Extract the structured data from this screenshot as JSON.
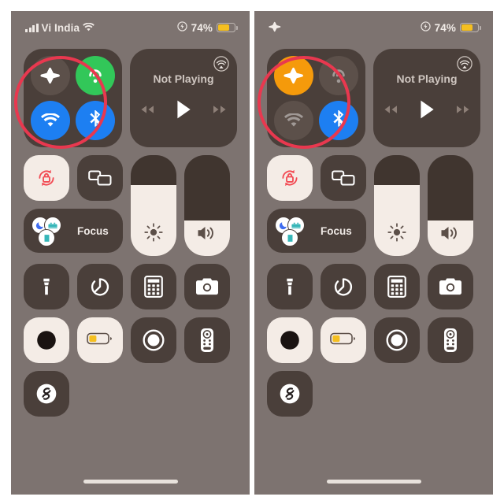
{
  "meta": {
    "screen_bg": "#7d7370",
    "tile_bg": "#4a3f3a",
    "accent_orange": "#f59a0b",
    "accent_blue": "#1d7ff2",
    "accent_green": "#32c759",
    "accent_red": "#e8384f",
    "active_tile_bg": "#f4ece6",
    "battery_yellow": "#f5bf20"
  },
  "panels": [
    {
      "id": "before",
      "status_bar": {
        "carrier": "Vi India",
        "signal_icon": "cellular-signal-icon",
        "wifi_icon": "wifi-icon",
        "airplane_icon": "",
        "lowpower_icon": "low-power-mode-icon",
        "battery_percent": "74%",
        "battery_level": 74
      },
      "connectivity": {
        "airplane": {
          "label": "Airplane Mode",
          "icon": "airplane-icon",
          "state": "off"
        },
        "cellular": {
          "label": "Cellular Data",
          "icon": "cellular-data-icon",
          "state": "on"
        },
        "wifi": {
          "label": "Wi-Fi",
          "icon": "wifi-icon",
          "state": "on"
        },
        "bluetooth": {
          "label": "Bluetooth",
          "icon": "bluetooth-icon",
          "state": "on"
        }
      },
      "media": {
        "title": "Not Playing",
        "airplay_icon": "airplay-audio-icon",
        "rewind_icon": "rewind-icon",
        "play_icon": "play-icon",
        "forward_icon": "fast-forward-icon"
      },
      "controls": {
        "rotation_lock": {
          "label": "Rotation Lock",
          "icon": "rotation-lock-icon",
          "state": "on"
        },
        "screen_mirroring": {
          "label": "Screen Mirroring",
          "icon": "screen-mirroring-icon",
          "state": "off"
        },
        "focus": {
          "label": "Focus",
          "icons": [
            "moon-icon",
            "bed-icon",
            "work-icon"
          ]
        },
        "brightness": {
          "label": "Display Brightness",
          "icon": "brightness-icon",
          "value": 70
        },
        "volume": {
          "label": "Volume",
          "icon": "volume-icon",
          "value": 35
        },
        "flashlight": {
          "label": "Flashlight",
          "icon": "flashlight-icon",
          "state": "off"
        },
        "timer": {
          "label": "Timer",
          "icon": "timer-icon",
          "state": "off"
        },
        "calculator": {
          "label": "Calculator",
          "icon": "calculator-icon",
          "state": "off"
        },
        "camera": {
          "label": "Camera",
          "icon": "camera-icon",
          "state": "off"
        },
        "dark_mode": {
          "label": "Dark Mode",
          "icon": "dark-mode-icon",
          "state": "on"
        },
        "low_power": {
          "label": "Low Power Mode",
          "icon": "battery-icon",
          "state": "on"
        },
        "screen_record": {
          "label": "Screen Recording",
          "icon": "screen-record-icon",
          "state": "off"
        },
        "apple_tv_remote": {
          "label": "Apple TV Remote",
          "icon": "tv-remote-icon",
          "state": "off"
        },
        "shazam": {
          "label": "Music Recognition",
          "icon": "shazam-icon",
          "state": "off"
        }
      },
      "annotation": {
        "shape": "circle",
        "target": "airplane-mode-toggle",
        "color": "#e8384f"
      },
      "home_indicator": true
    },
    {
      "id": "after",
      "status_bar": {
        "carrier": "",
        "signal_icon": "",
        "wifi_icon": "",
        "airplane_icon": "airplane-icon",
        "lowpower_icon": "low-power-mode-icon",
        "battery_percent": "74%",
        "battery_level": 74
      },
      "connectivity": {
        "airplane": {
          "label": "Airplane Mode",
          "icon": "airplane-icon",
          "state": "on"
        },
        "cellular": {
          "label": "Cellular Data",
          "icon": "cellular-data-icon",
          "state": "disabled"
        },
        "wifi": {
          "label": "Wi-Fi",
          "icon": "wifi-icon",
          "state": "disabled"
        },
        "bluetooth": {
          "label": "Bluetooth",
          "icon": "bluetooth-icon",
          "state": "on"
        }
      },
      "media": {
        "title": "Not Playing",
        "airplay_icon": "airplay-audio-icon",
        "rewind_icon": "rewind-icon",
        "play_icon": "play-icon",
        "forward_icon": "fast-forward-icon"
      },
      "controls": {
        "rotation_lock": {
          "label": "Rotation Lock",
          "icon": "rotation-lock-icon",
          "state": "on"
        },
        "screen_mirroring": {
          "label": "Screen Mirroring",
          "icon": "screen-mirroring-icon",
          "state": "off"
        },
        "focus": {
          "label": "Focus",
          "icons": [
            "moon-icon",
            "bed-icon",
            "work-icon"
          ]
        },
        "brightness": {
          "label": "Display Brightness",
          "icon": "brightness-icon",
          "value": 70
        },
        "volume": {
          "label": "Volume",
          "icon": "volume-icon",
          "value": 35
        },
        "flashlight": {
          "label": "Flashlight",
          "icon": "flashlight-icon",
          "state": "off"
        },
        "timer": {
          "label": "Timer",
          "icon": "timer-icon",
          "state": "off"
        },
        "calculator": {
          "label": "Calculator",
          "icon": "calculator-icon",
          "state": "off"
        },
        "camera": {
          "label": "Camera",
          "icon": "camera-icon",
          "state": "off"
        },
        "dark_mode": {
          "label": "Dark Mode",
          "icon": "dark-mode-icon",
          "state": "on"
        },
        "low_power": {
          "label": "Low Power Mode",
          "icon": "battery-icon",
          "state": "on"
        },
        "screen_record": {
          "label": "Screen Recording",
          "icon": "screen-record-icon",
          "state": "off"
        },
        "apple_tv_remote": {
          "label": "Apple TV Remote",
          "icon": "tv-remote-icon",
          "state": "off"
        },
        "shazam": {
          "label": "Music Recognition",
          "icon": "shazam-icon",
          "state": "off"
        }
      },
      "annotation": {
        "shape": "circle",
        "target": "airplane-mode-toggle",
        "color": "#e8384f"
      },
      "home_indicator": true
    }
  ]
}
